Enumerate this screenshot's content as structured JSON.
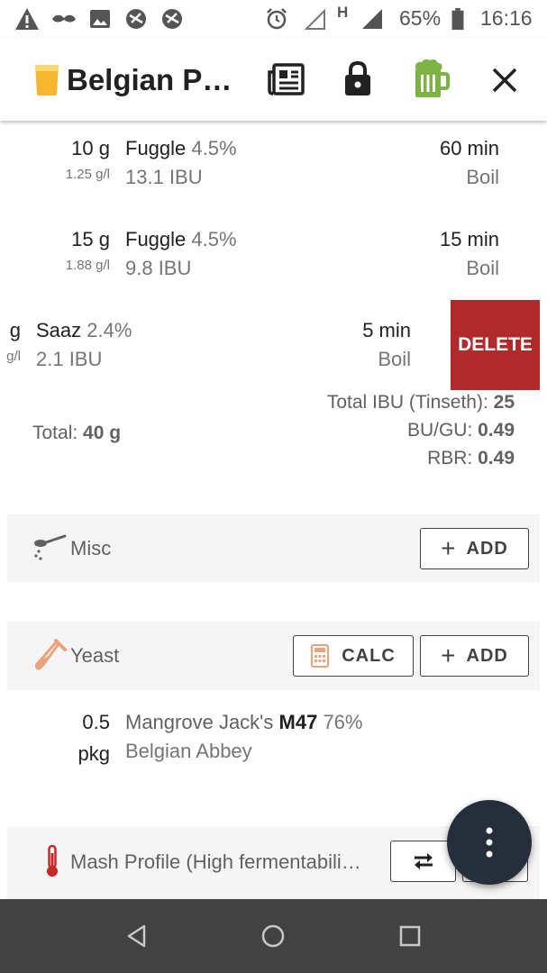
{
  "status_bar": {
    "battery": "65%",
    "time": "16:16",
    "network": "H"
  },
  "toolbar": {
    "title": "Belgian P…",
    "icons": [
      "beer-glass-icon",
      "newspaper-icon",
      "lock-icon",
      "beer-mug-icon",
      "close-icon"
    ]
  },
  "hops": [
    {
      "amount": "10 g",
      "concentration": "1.25 g/l",
      "name": "Fuggle",
      "alpha": "4.5%",
      "ibu": "13.1 IBU",
      "time": "60 min",
      "use": "Boil"
    },
    {
      "amount": "15 g",
      "concentration": "1.88 g/l",
      "name": "Fuggle",
      "alpha": "4.5%",
      "ibu": "9.8 IBU",
      "time": "15 min",
      "use": "Boil"
    },
    {
      "amount": "g",
      "concentration": "g/l",
      "name": "Saaz",
      "alpha": "2.4%",
      "ibu": "2.1 IBU",
      "time": "5 min",
      "use": "Boil"
    }
  ],
  "delete_label": "DELETE",
  "totals": {
    "total_label": "Total:",
    "total_value": "40 g",
    "ibu_label": "Total IBU (Tinseth):",
    "ibu_value": "25",
    "bugu_label": "BU/GU:",
    "bugu_value": "0.49",
    "rbr_label": "RBR:",
    "rbr_value": "0.49"
  },
  "misc": {
    "label": "Misc",
    "add_label": "ADD"
  },
  "yeast": {
    "label": "Yeast",
    "calc_label": "CALC",
    "add_label": "ADD",
    "item": {
      "amount_value": "0.5",
      "amount_unit": "pkg",
      "brand": "Mangrove Jack's",
      "code": "M47",
      "attenuation": "76%",
      "name": "Belgian Abbey"
    }
  },
  "mash": {
    "label": "Mash Profile (High fermentabili…"
  },
  "colors": {
    "accent_delete": "#b02a2a",
    "fab": "#262d3b",
    "navbar": "#424242",
    "section_bg": "#f5f5f5"
  }
}
